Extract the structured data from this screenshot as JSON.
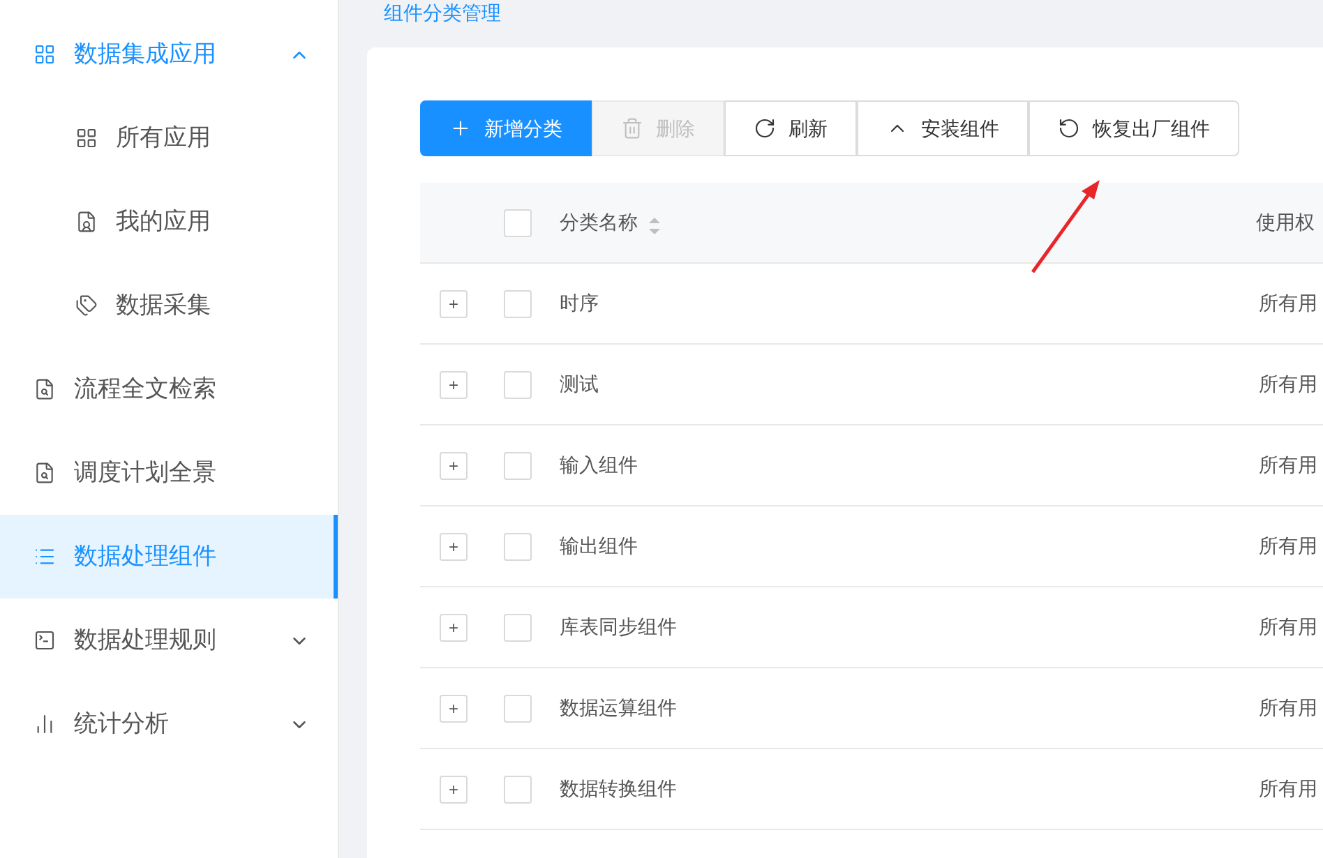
{
  "sidebar": {
    "items": [
      {
        "label": "数据集成应用",
        "selected": false,
        "expanded": true,
        "children": [
          {
            "label": "所有应用",
            "selected": false
          },
          {
            "label": "我的应用",
            "selected": false
          },
          {
            "label": "数据采集",
            "selected": false
          }
        ]
      },
      {
        "label": "流程全文检索",
        "selected": false
      },
      {
        "label": "调度计划全景",
        "selected": false
      },
      {
        "label": "数据处理组件",
        "selected": true
      },
      {
        "label": "数据处理规则",
        "selected": false,
        "expanded": false
      },
      {
        "label": "统计分析",
        "selected": false,
        "expanded": false
      }
    ]
  },
  "breadcrumb": "组件分类管理",
  "toolbar": [
    {
      "label": "新增分类",
      "kind": "primary",
      "disabled": false
    },
    {
      "label": "删除",
      "kind": "default",
      "disabled": true
    },
    {
      "label": "刷新",
      "kind": "default",
      "disabled": false
    },
    {
      "label": "安装组件",
      "kind": "default",
      "disabled": false
    },
    {
      "label": "恢复出厂组件",
      "kind": "default",
      "disabled": false
    }
  ],
  "table": {
    "header_checked": false,
    "columns": [
      "分类名称",
      "使用权"
    ],
    "rows": [
      {
        "expand": "+",
        "checked": false,
        "name": "时序",
        "column_2": "所有用"
      },
      {
        "expand": "+",
        "checked": false,
        "name": "测试",
        "column_2": "所有用"
      },
      {
        "expand": "+",
        "checked": false,
        "name": "输入组件",
        "column_2": "所有用"
      },
      {
        "expand": "+",
        "checked": false,
        "name": "输出组件",
        "column_2": "所有用"
      },
      {
        "expand": "+",
        "checked": false,
        "name": "库表同步组件",
        "column_2": "所有用"
      },
      {
        "expand": "+",
        "checked": false,
        "name": "数据运算组件",
        "column_2": "所有用"
      },
      {
        "expand": "+",
        "checked": false,
        "name": "数据转换组件",
        "column_2": "所有用"
      }
    ]
  }
}
